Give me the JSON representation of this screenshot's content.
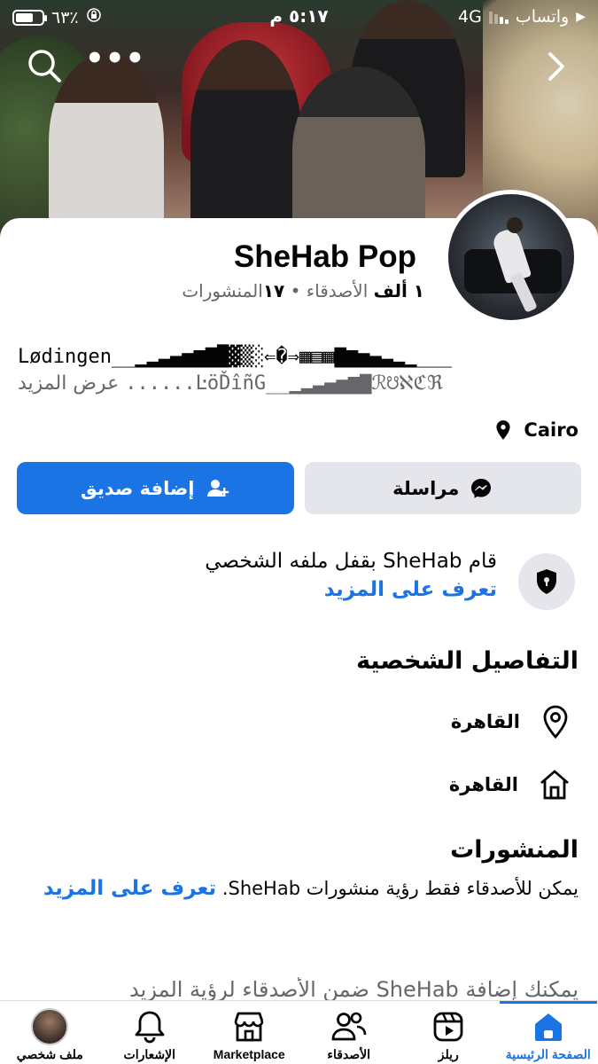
{
  "status_bar": {
    "carrier": "واتساب",
    "network": "4G",
    "time": "٥:١٧ م",
    "battery": "٦٣٪"
  },
  "profile": {
    "name": "SheHab Pop",
    "friends_count": "١ ألف",
    "friends_label": "الأصدقاء",
    "separator": "•",
    "posts_count": "١٧",
    "posts_label": "المنشورات",
    "bio_line1": "Lødingen__▁▂▃▄▅▆▇█▓▒░⇐�⇒▦▤▦▇▆▅▄▃▂▁___",
    "bio_line2": "......ĿöĎîñG__▁▂▃▄▅▆▇ℛ☋ℵℭℜ",
    "bio_more": "عرض المزيد",
    "location": "Cairo"
  },
  "actions": {
    "add_friend": "إضافة صديق",
    "message": "مراسلة"
  },
  "lock_notice": {
    "text": "قام SheHab بقفل ملفه الشخصي",
    "learn_more": "تعرف على المزيد"
  },
  "details": {
    "title": "التفاصيل الشخصية",
    "items": [
      {
        "icon": "location-pin-icon",
        "text": "القاهرة"
      },
      {
        "icon": "home-icon",
        "text": "القاهرة"
      }
    ]
  },
  "posts": {
    "title": "المنشورات",
    "text": "يمكن للأصدقاء فقط رؤية منشورات SheHab.",
    "learn_more": "تعرف على المزيد",
    "faded_text": "يمكنك إضافة SheHab ضمن الأصدقاء لرؤية المزيد"
  },
  "tabbar": {
    "items": [
      {
        "label": "الصفحة الرئيسية",
        "icon": "home-icon",
        "active": true
      },
      {
        "label": "ريلز",
        "icon": "reels-icon",
        "active": false
      },
      {
        "label": "الأصدقاء",
        "icon": "friends-icon",
        "active": false
      },
      {
        "label": "Marketplace",
        "icon": "marketplace-icon",
        "active": false
      },
      {
        "label": "الإشعارات",
        "icon": "bell-icon",
        "active": false
      },
      {
        "label": "ملف شخصي",
        "icon": "avatar",
        "active": false
      }
    ]
  },
  "colors": {
    "accent": "#1b74e4",
    "secondary_button": "#e4e6eb",
    "muted_text": "#65676b"
  }
}
